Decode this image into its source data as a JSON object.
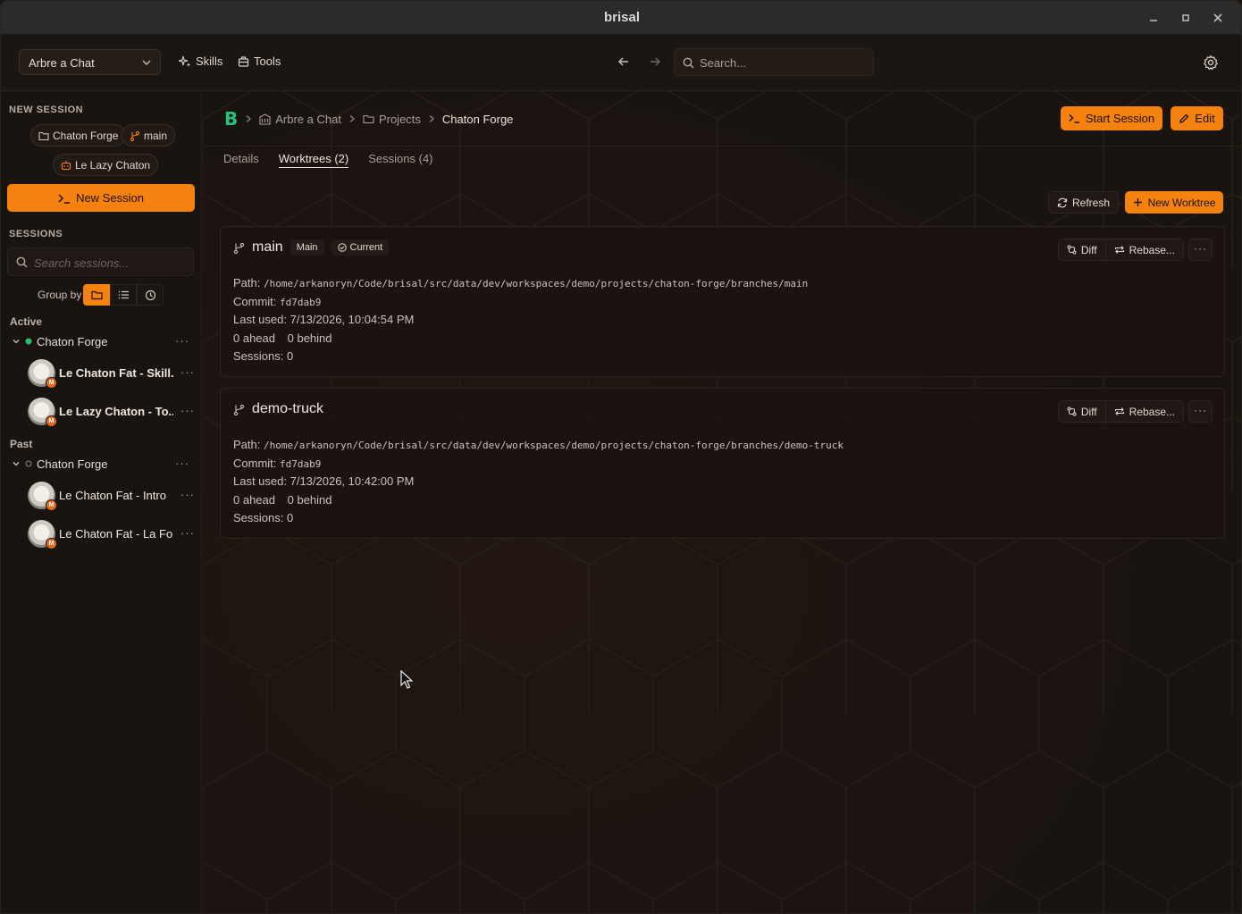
{
  "window": {
    "title": "brisal"
  },
  "toolbar": {
    "workspace": "Arbre a Chat",
    "skills_label": "Skills",
    "tools_label": "Tools",
    "search_placeholder": "Search..."
  },
  "sidebar": {
    "new_session_title": "NEW SESSION",
    "chips": {
      "project": "Chaton Forge",
      "branch": "main",
      "agent": "Le Lazy Chaton"
    },
    "new_session_button": "New Session",
    "sessions_title": "SESSIONS",
    "search_placeholder": "Search sessions...",
    "group_by_label": "Group by",
    "active_label": "Active",
    "past_label": "Past",
    "active_group": {
      "name": "Chaton Forge",
      "sessions": [
        {
          "name": "Le Chaton Fat - Skill...",
          "badge": "M"
        },
        {
          "name": "Le Lazy Chaton - To...",
          "badge": "M"
        }
      ]
    },
    "past_group": {
      "name": "Chaton Forge",
      "sessions": [
        {
          "name": "Le Chaton Fat - Intro",
          "badge": "M"
        },
        {
          "name": "Le Chaton Fat - La Fo...",
          "badge": "M"
        }
      ]
    }
  },
  "main": {
    "logo": "B",
    "breadcrumb": [
      "Arbre a Chat",
      "Projects",
      "Chaton Forge"
    ],
    "start_session_button": "Start Session",
    "edit_button": "Edit",
    "tabs": [
      "Details",
      "Worktrees (2)",
      "Sessions (4)"
    ],
    "refresh_button": "Refresh",
    "new_worktree_button": "New Worktree",
    "worktrees": [
      {
        "name": "main",
        "tag_main": "Main",
        "tag_current": "Current",
        "path_label": "Path:",
        "path": "/home/arkanoryn/Code/brisal/src/data/dev/workspaces/demo/projects/chaton-forge/branches/main",
        "commit_label": "Commit:",
        "commit": "fd7dab9",
        "last_used": "Last used: 7/13/2026, 10:04:54 PM",
        "ahead": "0 ahead",
        "behind": "0 behind",
        "sessions": "Sessions: 0",
        "diff_label": "Diff",
        "rebase_label": "Rebase..."
      },
      {
        "name": "demo-truck",
        "path_label": "Path:",
        "path": "/home/arkanoryn/Code/brisal/src/data/dev/workspaces/demo/projects/chaton-forge/branches/demo-truck",
        "commit_label": "Commit:",
        "commit": "fd7dab9",
        "last_used": "Last used: 7/13/2026, 10:42:00 PM",
        "ahead": "0 ahead",
        "behind": "0 behind",
        "sessions": "Sessions: 0",
        "diff_label": "Diff",
        "rebase_label": "Rebase..."
      }
    ]
  },
  "colors": {
    "accent": "#f5820f",
    "logo": "#27c07c",
    "active_dot": "#2fbf71"
  }
}
